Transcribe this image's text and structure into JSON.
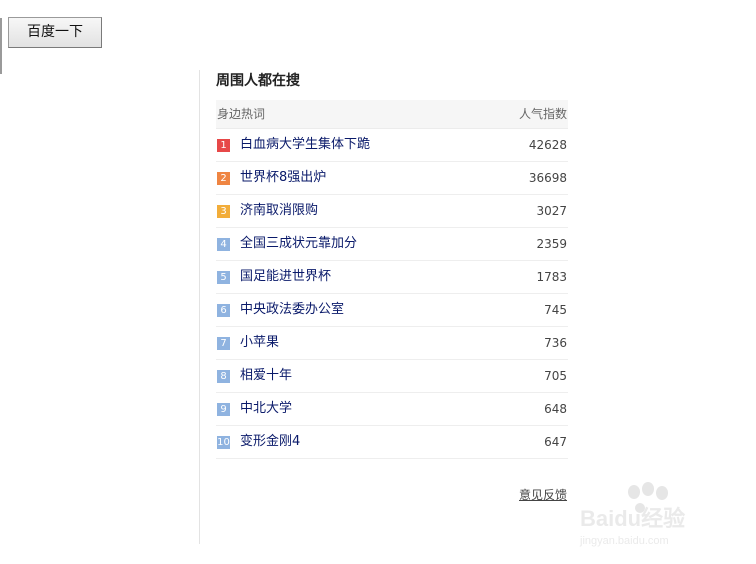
{
  "search_button": {
    "label": "百度一下"
  },
  "panel": {
    "title": "周围人都在搜",
    "header_term": "身边热词",
    "header_score": "人气指数",
    "items": [
      {
        "rank": "1",
        "term": "白血病大学生集体下跪",
        "score": "42628",
        "rank_color": "#e74848"
      },
      {
        "rank": "2",
        "term": "世界杯8强出炉",
        "score": "36698",
        "rank_color": "#ef8542"
      },
      {
        "rank": "3",
        "term": "济南取消限购",
        "score": "3027",
        "rank_color": "#f2ad3a"
      },
      {
        "rank": "4",
        "term": "全国三成状元靠加分",
        "score": "2359",
        "rank_color": "#8fb3e0"
      },
      {
        "rank": "5",
        "term": "国足能进世界杯",
        "score": "1783",
        "rank_color": "#8fb3e0"
      },
      {
        "rank": "6",
        "term": "中央政法委办公室",
        "score": "745",
        "rank_color": "#8fb3e0"
      },
      {
        "rank": "7",
        "term": "小苹果",
        "score": "736",
        "rank_color": "#8fb3e0"
      },
      {
        "rank": "8",
        "term": "相爱十年",
        "score": "705",
        "rank_color": "#8fb3e0"
      },
      {
        "rank": "9",
        "term": "中北大学",
        "score": "648",
        "rank_color": "#8fb3e0"
      },
      {
        "rank": "10",
        "term": "变形金刚4",
        "score": "647",
        "rank_color": "#8fb3e0"
      }
    ],
    "feedback_label": "意见反馈"
  },
  "watermark": {
    "brand": "Baidu经验",
    "url": "jingyan.baidu.com"
  }
}
